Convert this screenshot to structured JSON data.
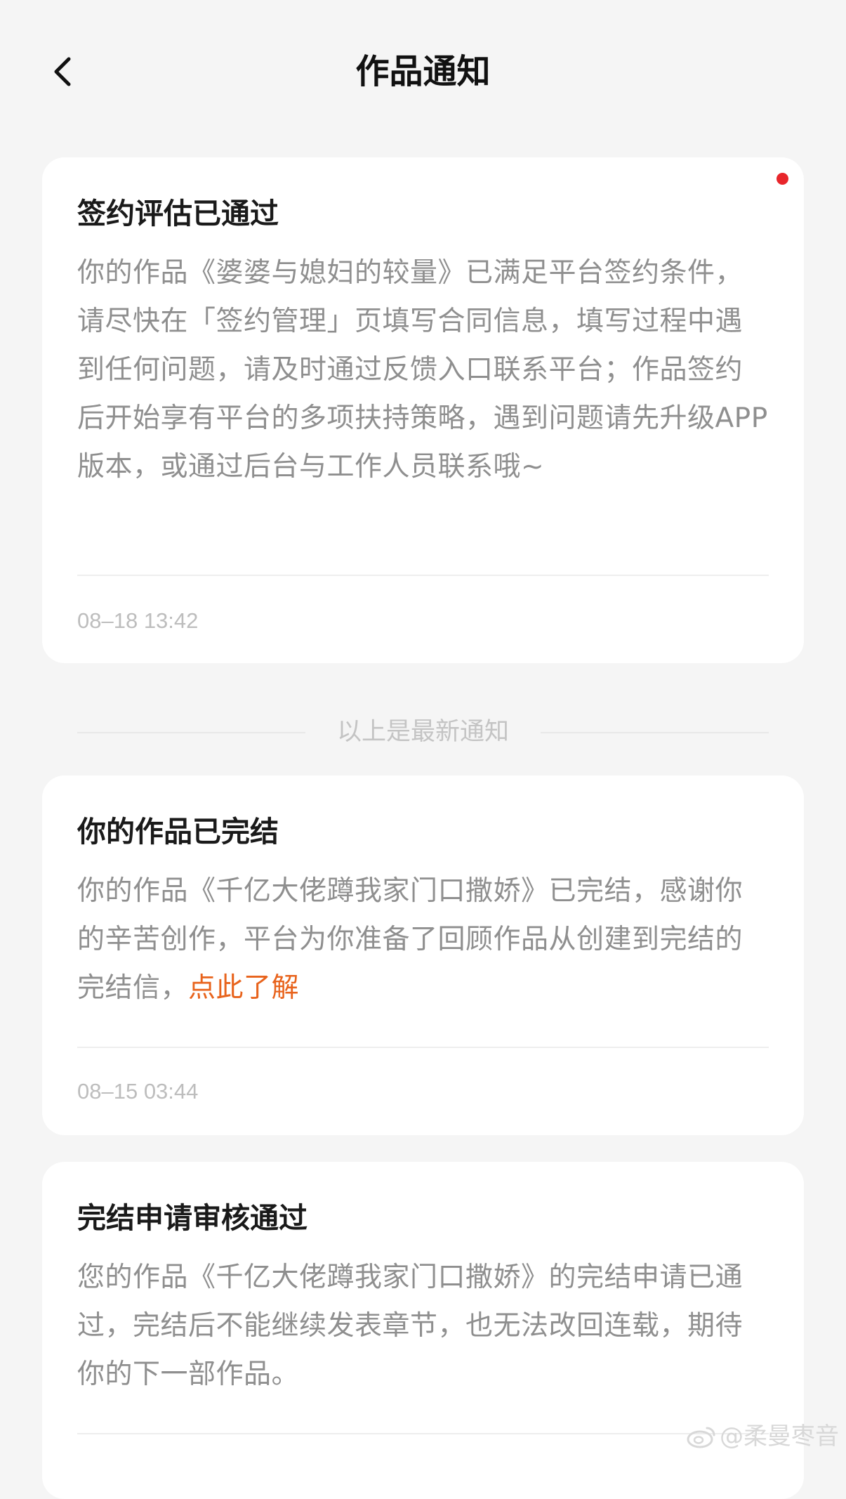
{
  "header": {
    "title": "作品通知"
  },
  "notifications": [
    {
      "title": "签约评估已通过",
      "body": "你的作品《婆婆与媳妇的较量》已满足平台签约条件，请尽快在「签约管理」页填写合同信息，填写过程中遇到任何问题，请及时通过反馈入口联系平台；作品签约后开始享有平台的多项扶持策略，遇到问题请先升级APP版本，或通过后台与工作人员联系哦~",
      "time": "08–18 13:42",
      "unread": true
    },
    {
      "title": "你的作品已完结",
      "body": "你的作品《千亿大佬蹲我家门口撒娇》已完结，感谢你的辛苦创作，平台为你准备了回顾作品从创建到完结的完结信，",
      "link": "点此了解",
      "time": "08–15 03:44"
    },
    {
      "title": "完结申请审核通过",
      "body": "您的作品《千亿大佬蹲我家门口撒娇》的完结申请已通过，完结后不能继续发表章节，也无法改回连载，期待你的下一部作品。"
    }
  ],
  "separator": {
    "text": "以上是最新通知"
  },
  "watermark": {
    "text": "@柔曼枣音"
  },
  "colors": {
    "background": "#f5f5f5",
    "card": "#ffffff",
    "unread_dot": "#e8262b",
    "link": "#e8631c",
    "body_text": "#8f8f8f"
  }
}
